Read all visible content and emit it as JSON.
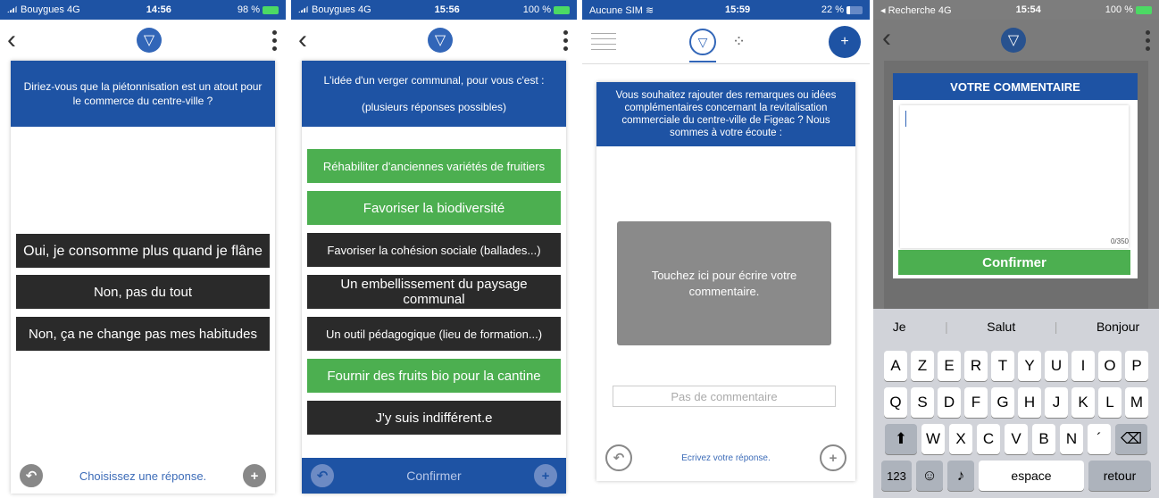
{
  "screen1": {
    "status": {
      "carrier": "Bouygues 4G",
      "time": "14:56",
      "battery": "98 %"
    },
    "question": "Diriez-vous que la piétonnisation est un atout pour le commerce du centre-ville ?",
    "options": [
      "Oui, je consomme plus quand je flâne",
      "Non, pas du tout",
      "Non, ça ne change pas mes habitudes"
    ],
    "footer": "Choisissez une réponse."
  },
  "screen2": {
    "status": {
      "carrier": "Bouygues 4G",
      "time": "15:56",
      "battery": "100 %"
    },
    "question": "L'idée d'un verger communal, pour vous c'est :",
    "subtitle": "(plusieurs réponses possibles)",
    "options": [
      {
        "label": "Réhabiliter d'anciennes variétés de fruitiers",
        "selected": true
      },
      {
        "label": "Favoriser la biodiversité",
        "selected": true
      },
      {
        "label": "Favoriser la cohésion sociale (ballades...)",
        "selected": false
      },
      {
        "label": "Un embellissement du paysage communal",
        "selected": false
      },
      {
        "label": "Un outil pédagogique (lieu de formation...)",
        "selected": false
      },
      {
        "label": "Fournir des fruits bio pour la cantine",
        "selected": true
      },
      {
        "label": "J'y suis indifférent.e",
        "selected": false
      }
    ],
    "footer": "Confirmer"
  },
  "screen3": {
    "status": {
      "carrier": "Aucune SIM",
      "time": "15:59",
      "battery": "22 %"
    },
    "question": "Vous souhaitez rajouter des remarques ou idées complémentaires concernant la revitalisation commerciale du centre-ville de Figeac ? Nous sommes à votre écoute :",
    "tap_box": "Touchez ici pour écrire votre commentaire.",
    "placeholder": "Pas de commentaire",
    "footer": "Ecrivez votre réponse.",
    "add_label": "+"
  },
  "screen4": {
    "status": {
      "carrier": "◂ Recherche 4G",
      "time": "15:54",
      "battery": "100 %"
    },
    "modal_title": "VOTRE COMMENTAIRE",
    "counter": "0/350",
    "confirm": "Confirmer",
    "suggestions": [
      "Je",
      "Salut",
      "Bonjour"
    ],
    "row1": [
      "A",
      "Z",
      "E",
      "R",
      "T",
      "Y",
      "U",
      "I",
      "O",
      "P"
    ],
    "row2": [
      "Q",
      "S",
      "D",
      "F",
      "G",
      "H",
      "J",
      "K",
      "L",
      "M"
    ],
    "row3": [
      "W",
      "X",
      "C",
      "V",
      "B",
      "N",
      "´"
    ],
    "num_key": "123",
    "space_key": "espace",
    "return_key": "retour"
  }
}
